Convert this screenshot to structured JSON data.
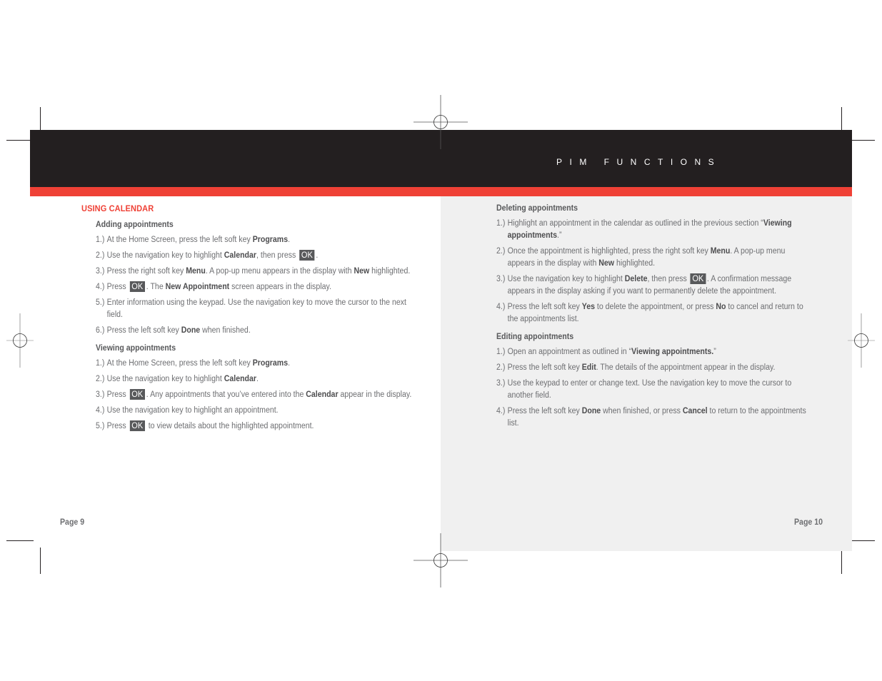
{
  "header": {
    "section_title": "PIM FUNCTIONS",
    "colors": {
      "bar": "#231f20",
      "accent": "#ef4136",
      "panel": "#f0f0f0"
    }
  },
  "left_page": {
    "heading": "USING CALENDAR",
    "sections": [
      {
        "title": "Adding appointments",
        "steps": [
          {
            "num": "1.)",
            "parts": [
              {
                "t": "At the Home Screen, press the left soft key "
              },
              {
                "b": "Programs"
              },
              {
                "t": "."
              }
            ]
          },
          {
            "num": "2.)",
            "parts": [
              {
                "t": "Use the navigation key to highlight "
              },
              {
                "b": "Calendar"
              },
              {
                "t": ", then press "
              },
              {
                "key": "OK"
              },
              {
                "t": "."
              }
            ]
          },
          {
            "num": "3.)",
            "parts": [
              {
                "t": "Press the right soft key "
              },
              {
                "b": "Menu"
              },
              {
                "t": ". A pop-up menu appears in the display with "
              },
              {
                "b": "New"
              },
              {
                "t": " highlighted."
              }
            ]
          },
          {
            "num": "4.)",
            "parts": [
              {
                "t": "Press "
              },
              {
                "key": "OK"
              },
              {
                "t": ". The "
              },
              {
                "b": "New Appointment"
              },
              {
                "t": " screen appears in the display."
              }
            ]
          },
          {
            "num": "5.)",
            "parts": [
              {
                "t": "Enter information using the keypad. Use the navigation key to move the cursor to the next field."
              }
            ]
          },
          {
            "num": "6.)",
            "parts": [
              {
                "t": "Press the left soft key "
              },
              {
                "b": "Done"
              },
              {
                "t": " when finished."
              }
            ]
          }
        ]
      },
      {
        "title": "Viewing appointments",
        "steps": [
          {
            "num": "1.)",
            "parts": [
              {
                "t": "At the Home Screen, press the left soft key "
              },
              {
                "b": "Programs"
              },
              {
                "t": "."
              }
            ]
          },
          {
            "num": "2.)",
            "parts": [
              {
                "t": "Use the navigation key to highlight "
              },
              {
                "b": "Calendar"
              },
              {
                "t": "."
              }
            ]
          },
          {
            "num": "3.)",
            "parts": [
              {
                "t": "Press "
              },
              {
                "key": "OK"
              },
              {
                "t": ". Any appointments that you’ve entered into the "
              },
              {
                "b": "Calendar"
              },
              {
                "t": " appear in the display."
              }
            ]
          },
          {
            "num": "4.)",
            "parts": [
              {
                "t": "Use the navigation key to highlight an appointment."
              }
            ]
          },
          {
            "num": "5.)",
            "parts": [
              {
                "t": "Press "
              },
              {
                "key": "OK"
              },
              {
                "t": " to view details about the highlighted appointment."
              }
            ]
          }
        ]
      }
    ],
    "page_label": "Page 9"
  },
  "right_page": {
    "sections": [
      {
        "title": "Deleting appointments",
        "steps": [
          {
            "num": "1.)",
            "parts": [
              {
                "t": "Highlight an appointment in the calendar as outlined in the previous section “"
              },
              {
                "b": "Viewing appointments"
              },
              {
                "t": ".”"
              }
            ]
          },
          {
            "num": "2.)",
            "parts": [
              {
                "t": "Once the appointment is highlighted, press the right soft key "
              },
              {
                "b": "Menu"
              },
              {
                "t": ". A pop-up menu appears in the display with "
              },
              {
                "b": "New"
              },
              {
                "t": " highlighted."
              }
            ]
          },
          {
            "num": "3.)",
            "parts": [
              {
                "t": "Use the navigation key to highlight "
              },
              {
                "b": "Delete"
              },
              {
                "t": ", then press "
              },
              {
                "key": "OK"
              },
              {
                "t": ". A confirmation message appears in the display asking if you want to permanently delete the appointment."
              }
            ]
          },
          {
            "num": "4.)",
            "parts": [
              {
                "t": "Press the left soft key "
              },
              {
                "b": "Yes"
              },
              {
                "t": " to delete the appointment, or press "
              },
              {
                "b": "No"
              },
              {
                "t": " to cancel and return to the appointments list."
              }
            ]
          }
        ]
      },
      {
        "title": "Editing appointments",
        "steps": [
          {
            "num": "1.)",
            "parts": [
              {
                "t": "Open an appointment as outlined in “"
              },
              {
                "b": "Viewing appointments."
              },
              {
                "t": "”"
              }
            ]
          },
          {
            "num": "2.)",
            "parts": [
              {
                "t": "Press the left soft key "
              },
              {
                "b": "Edit"
              },
              {
                "t": ". The details of the appointment appear in the display."
              }
            ]
          },
          {
            "num": "3.)",
            "parts": [
              {
                "t": "Use the keypad to enter or change text. Use the navigation key to move the cursor to another field."
              }
            ]
          },
          {
            "num": "4.)",
            "parts": [
              {
                "t": "Press the left soft key "
              },
              {
                "b": "Done"
              },
              {
                "t": " when finished, or press "
              },
              {
                "b": "Cancel"
              },
              {
                "t": " to return to the appointments list."
              }
            ]
          }
        ]
      }
    ],
    "page_label": "Page 10"
  }
}
